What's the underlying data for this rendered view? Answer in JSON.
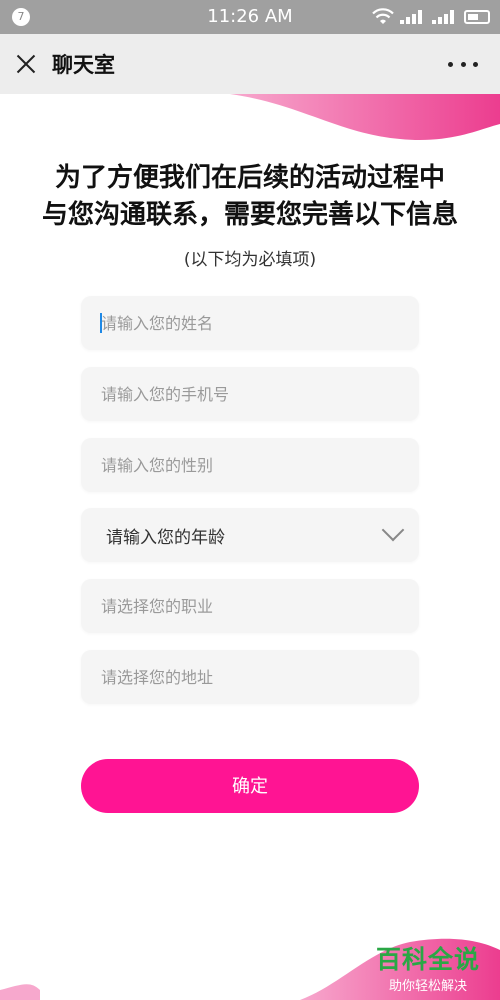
{
  "status_bar": {
    "notification_badge": "7",
    "time": "11:26 AM"
  },
  "title_bar": {
    "title": "聊天室"
  },
  "form": {
    "heading_line1": "为了方便我们在后续的活动过程中",
    "heading_line2": "与您沟通联系，需要您完善以下信息",
    "subheading": "(以下均为必填项)",
    "name_placeholder": "请输入您的姓名",
    "phone_placeholder": "请输入您的手机号",
    "gender_placeholder": "请输入您的性别",
    "age_select_label": "请输入您的年龄",
    "job_placeholder": "请选择您的职业",
    "address_placeholder": "请选择您的地址",
    "submit_label": "确定"
  },
  "watermark": {
    "title": "百科全说",
    "subtitle": "助你轻松解决"
  },
  "colors": {
    "accent": "#ff1493",
    "wave": "#f0559f",
    "watermark_green": "#2aa745"
  }
}
